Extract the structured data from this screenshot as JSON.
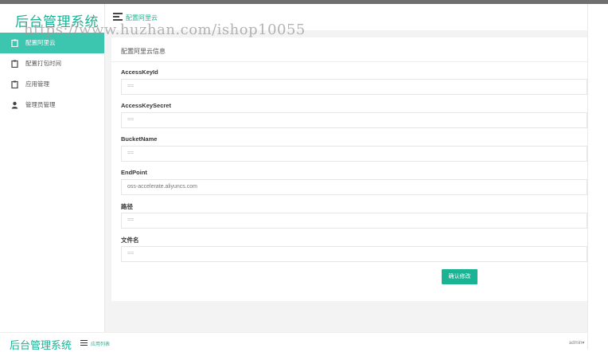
{
  "app": {
    "brand": "后台管理系统",
    "watermark": "https://www.huzhan.com/ishop10055"
  },
  "topbar": {
    "breadcrumb": "配置阿里云"
  },
  "sidebar": {
    "items": [
      {
        "label": "配置阿里云",
        "icon": "clipboard-icon",
        "active": true
      },
      {
        "label": "配置打包时间",
        "icon": "clipboard-icon",
        "active": false
      },
      {
        "label": "应用管理",
        "icon": "clipboard-icon",
        "active": false
      },
      {
        "label": "管理员管理",
        "icon": "user-icon",
        "active": false
      }
    ]
  },
  "panel": {
    "title": "配置阿里云信息",
    "fields": [
      {
        "label": "AccessKeyId",
        "value": "",
        "placeholder": "=="
      },
      {
        "label": "AccessKeySecret",
        "value": "",
        "placeholder": "=="
      },
      {
        "label": "BucketName",
        "value": "",
        "placeholder": "=="
      },
      {
        "label": "EndPoint",
        "value": "oss-accelerate.aliyuncs.com",
        "placeholder": ""
      },
      {
        "label": "路径",
        "value": "",
        "placeholder": "=="
      },
      {
        "label": "文件名",
        "value": "",
        "placeholder": "=="
      }
    ],
    "submit_label": "确认修改"
  },
  "footer": {
    "brand": "后台管理系统",
    "breadcrumb": "应用列表",
    "user": "admin▾"
  },
  "colors": {
    "accent": "#1ab394",
    "active_nav": "#3cc6b0",
    "content_bg": "#f3f3f4"
  }
}
